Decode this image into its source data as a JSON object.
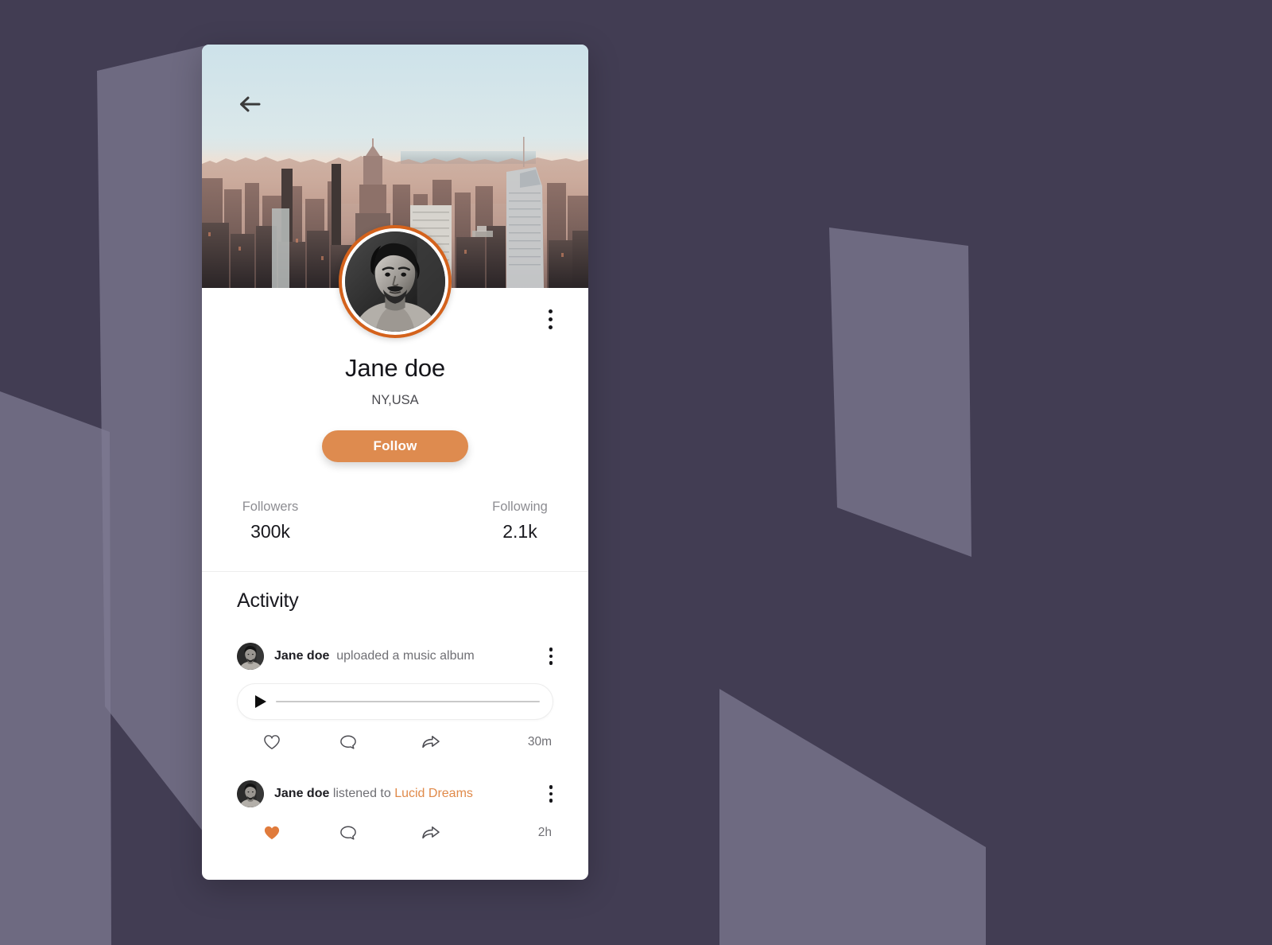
{
  "background": {
    "base_color": "#423D53",
    "shape_color": "#807C93"
  },
  "profile": {
    "back_icon": "arrow-left-icon",
    "menu_icon": "kebab-menu-icon",
    "name": "Jane doe",
    "location": "NY,USA",
    "follow_label": "Follow",
    "accent_color": "#DE8B4F",
    "avatar_ring_color": "#D4621C",
    "stats": [
      {
        "label": "Followers",
        "value": "300k"
      },
      {
        "label": "Following",
        "value": "2.1k"
      }
    ]
  },
  "activity": {
    "title": "Activity",
    "items": [
      {
        "user": "Jane doe",
        "action": "uploaded a music album",
        "highlight": "",
        "has_player": true,
        "liked": false,
        "time": "30m",
        "like_icon": "heart-outline-icon",
        "comment_icon": "comment-bubble-icon",
        "share_icon": "share-arrow-icon",
        "menu_icon": "kebab-menu-icon",
        "play_icon": "play-triangle-icon"
      },
      {
        "user": "Jane doe",
        "action": "listened to ",
        "highlight": "Lucid Dreams",
        "has_player": false,
        "liked": true,
        "time": "2h",
        "like_icon": "heart-filled-icon",
        "comment_icon": "comment-bubble-icon",
        "share_icon": "share-arrow-icon",
        "menu_icon": "kebab-menu-icon"
      }
    ]
  }
}
